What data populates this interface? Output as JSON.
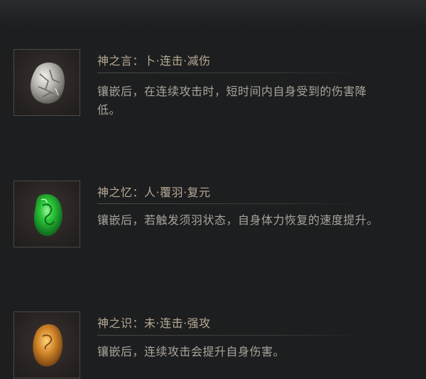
{
  "items": [
    {
      "title": "神之言：卜·连击·减伤",
      "desc_line1": "镶嵌后，在连续攻击时，短时间内自身受到的伤害降",
      "desc_line2": "低。",
      "icon": "silver-stone-icon"
    },
    {
      "title": "神之忆：人·覆羽·复元",
      "desc_line1": "镶嵌后，若触发须羽状态，自身体力恢复的速度提升。",
      "icon": "green-jade-icon"
    },
    {
      "title": "神之识：未·连击·强攻",
      "desc_line1": "镶嵌后，连续攻击会提升自身伤害。",
      "icon": "amber-stone-icon"
    }
  ],
  "colors": {
    "background": "#1d1e1f",
    "title": "#b7aa94",
    "text": "#a8a49c"
  }
}
